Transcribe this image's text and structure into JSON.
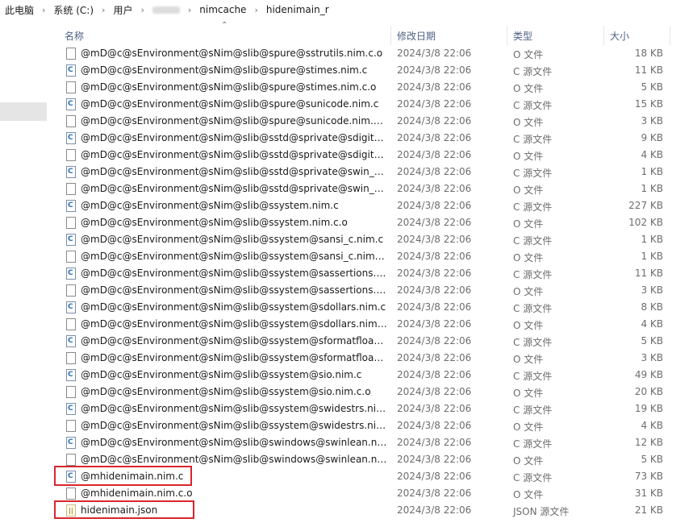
{
  "breadcrumb": {
    "items": [
      "此电脑",
      "系统 (C:)",
      "用户",
      "",
      "nimcache",
      "hidenimain_r"
    ],
    "separator": "›"
  },
  "columns": {
    "name": "名称",
    "modified": "修改日期",
    "type": "类型",
    "size": "大小"
  },
  "files": [
    {
      "name": "@mD@c@sEnvironment@sNim@slib@spure@sstrutils.nim.c.o",
      "date": "2024/3/8 22:06",
      "type": "O 文件",
      "size": "18 KB",
      "icon": "o-file-icon"
    },
    {
      "name": "@mD@c@sEnvironment@sNim@slib@spure@stimes.nim.c",
      "date": "2024/3/8 22:06",
      "type": "C 源文件",
      "size": "11 KB",
      "icon": "c-file-icon"
    },
    {
      "name": "@mD@c@sEnvironment@sNim@slib@spure@stimes.nim.c.o",
      "date": "2024/3/8 22:06",
      "type": "O 文件",
      "size": "5 KB",
      "icon": "o-file-icon"
    },
    {
      "name": "@mD@c@sEnvironment@sNim@slib@spure@sunicode.nim.c",
      "date": "2024/3/8 22:06",
      "type": "C 源文件",
      "size": "15 KB",
      "icon": "c-file-icon"
    },
    {
      "name": "@mD@c@sEnvironment@sNim@slib@spure@sunicode.nim.c.o",
      "date": "2024/3/8 22:06",
      "type": "O 文件",
      "size": "3 KB",
      "icon": "o-file-icon"
    },
    {
      "name": "@mD@c@sEnvironment@sNim@slib@sstd@sprivate@sdigitsut...",
      "date": "2024/3/8 22:06",
      "type": "C 源文件",
      "size": "9 KB",
      "icon": "c-file-icon"
    },
    {
      "name": "@mD@c@sEnvironment@sNim@slib@sstd@sprivate@sdigitsut...",
      "date": "2024/3/8 22:06",
      "type": "O 文件",
      "size": "4 KB",
      "icon": "o-file-icon"
    },
    {
      "name": "@mD@c@sEnvironment@sNim@slib@sstd@sprivate@swin_set...",
      "date": "2024/3/8 22:06",
      "type": "C 源文件",
      "size": "1 KB",
      "icon": "c-file-icon"
    },
    {
      "name": "@mD@c@sEnvironment@sNim@slib@sstd@sprivate@swin_set...",
      "date": "2024/3/8 22:06",
      "type": "O 文件",
      "size": "1 KB",
      "icon": "o-file-icon"
    },
    {
      "name": "@mD@c@sEnvironment@sNim@slib@ssystem.nim.c",
      "date": "2024/3/8 22:06",
      "type": "C 源文件",
      "size": "227 KB",
      "icon": "c-file-icon"
    },
    {
      "name": "@mD@c@sEnvironment@sNim@slib@ssystem.nim.c.o",
      "date": "2024/3/8 22:06",
      "type": "O 文件",
      "size": "102 KB",
      "icon": "o-file-icon"
    },
    {
      "name": "@mD@c@sEnvironment@sNim@slib@ssystem@sansi_c.nim.c",
      "date": "2024/3/8 22:06",
      "type": "C 源文件",
      "size": "1 KB",
      "icon": "c-file-icon"
    },
    {
      "name": "@mD@c@sEnvironment@sNim@slib@ssystem@sansi_c.nim.c.o",
      "date": "2024/3/8 22:06",
      "type": "O 文件",
      "size": "1 KB",
      "icon": "o-file-icon"
    },
    {
      "name": "@mD@c@sEnvironment@sNim@slib@ssystem@sassertions.ni...",
      "date": "2024/3/8 22:06",
      "type": "C 源文件",
      "size": "11 KB",
      "icon": "c-file-icon"
    },
    {
      "name": "@mD@c@sEnvironment@sNim@slib@ssystem@sassertions.ni...",
      "date": "2024/3/8 22:06",
      "type": "O 文件",
      "size": "3 KB",
      "icon": "o-file-icon"
    },
    {
      "name": "@mD@c@sEnvironment@sNim@slib@ssystem@sdollars.nim.c",
      "date": "2024/3/8 22:06",
      "type": "C 源文件",
      "size": "8 KB",
      "icon": "c-file-icon"
    },
    {
      "name": "@mD@c@sEnvironment@sNim@slib@ssystem@sdollars.nim.c.o",
      "date": "2024/3/8 22:06",
      "type": "O 文件",
      "size": "4 KB",
      "icon": "o-file-icon"
    },
    {
      "name": "@mD@c@sEnvironment@sNim@slib@ssystem@sformatfloat.ni...",
      "date": "2024/3/8 22:06",
      "type": "C 源文件",
      "size": "5 KB",
      "icon": "c-file-icon"
    },
    {
      "name": "@mD@c@sEnvironment@sNim@slib@ssystem@sformatfloat.ni...",
      "date": "2024/3/8 22:06",
      "type": "O 文件",
      "size": "3 KB",
      "icon": "o-file-icon"
    },
    {
      "name": "@mD@c@sEnvironment@sNim@slib@ssystem@sio.nim.c",
      "date": "2024/3/8 22:06",
      "type": "C 源文件",
      "size": "49 KB",
      "icon": "c-file-icon"
    },
    {
      "name": "@mD@c@sEnvironment@sNim@slib@ssystem@sio.nim.c.o",
      "date": "2024/3/8 22:06",
      "type": "O 文件",
      "size": "20 KB",
      "icon": "o-file-icon"
    },
    {
      "name": "@mD@c@sEnvironment@sNim@slib@ssystem@swidestrs.nim.c",
      "date": "2024/3/8 22:06",
      "type": "C 源文件",
      "size": "19 KB",
      "icon": "c-file-icon"
    },
    {
      "name": "@mD@c@sEnvironment@sNim@slib@ssystem@swidestrs.nim....",
      "date": "2024/3/8 22:06",
      "type": "O 文件",
      "size": "4 KB",
      "icon": "o-file-icon"
    },
    {
      "name": "@mD@c@sEnvironment@sNim@slib@swindows@swinlean.nim.c",
      "date": "2024/3/8 22:06",
      "type": "C 源文件",
      "size": "12 KB",
      "icon": "c-file-icon"
    },
    {
      "name": "@mD@c@sEnvironment@sNim@slib@swindows@swinlean.nim....",
      "date": "2024/3/8 22:06",
      "type": "O 文件",
      "size": "5 KB",
      "icon": "o-file-icon"
    },
    {
      "name": "@mhidenimain.nim.c",
      "date": "2024/3/8 22:06",
      "type": "C 源文件",
      "size": "73 KB",
      "icon": "c-file-icon"
    },
    {
      "name": "@mhidenimain.nim.c.o",
      "date": "2024/3/8 22:06",
      "type": "O 文件",
      "size": "31 KB",
      "icon": "o-file-icon"
    },
    {
      "name": "hidenimain.json",
      "date": "2024/3/8 22:06",
      "type": "JSON 源文件",
      "size": "21 KB",
      "icon": "json-file-icon"
    }
  ],
  "highlight_color": "#d9262c"
}
